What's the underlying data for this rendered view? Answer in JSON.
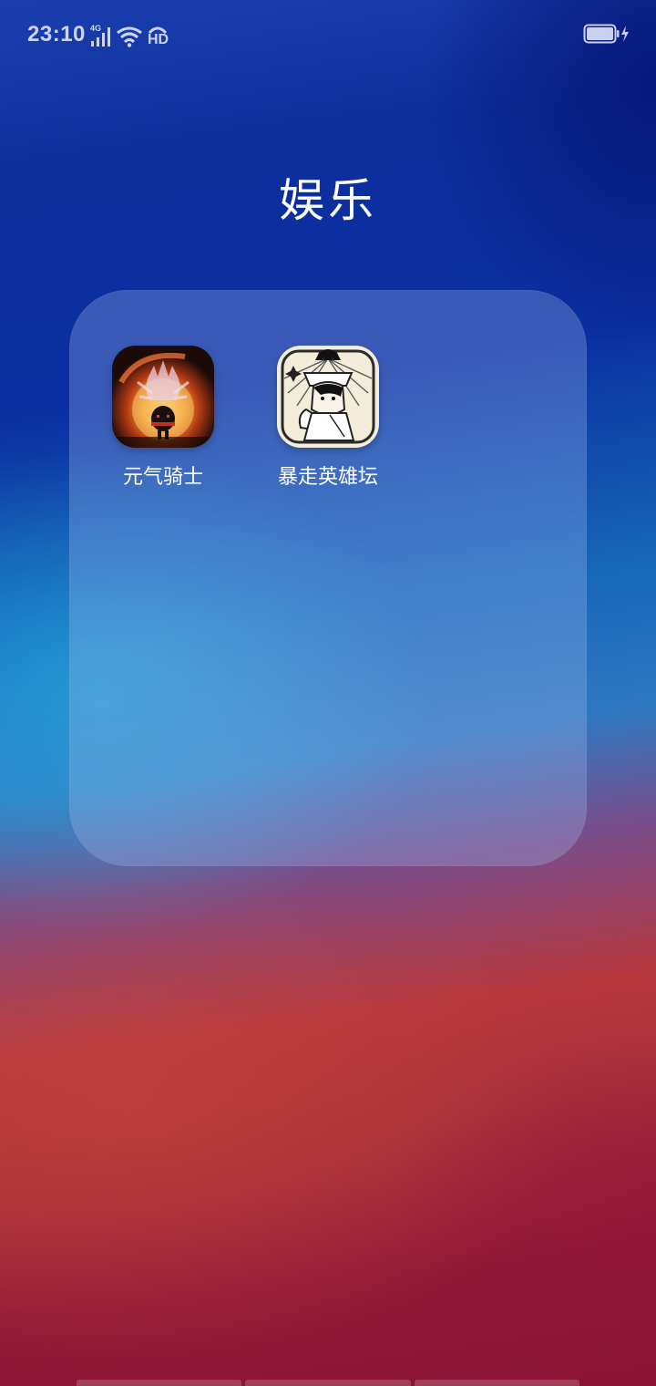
{
  "status_bar": {
    "time": "23:10",
    "network_label": "4G",
    "hd_label": "HD",
    "icons": [
      "signal-icon",
      "wifi-icon",
      "hd-call-icon",
      "battery-charging-icon"
    ]
  },
  "folder": {
    "title": "娱乐",
    "apps": [
      {
        "label": "元气骑士",
        "icon": "soul-knight-icon"
      },
      {
        "label": "暴走英雄坛",
        "icon": "manga-hero-icon"
      }
    ]
  },
  "colors": {
    "title_text": "#ffffff",
    "folder_panel": "rgba(160,185,235,0.32)"
  }
}
